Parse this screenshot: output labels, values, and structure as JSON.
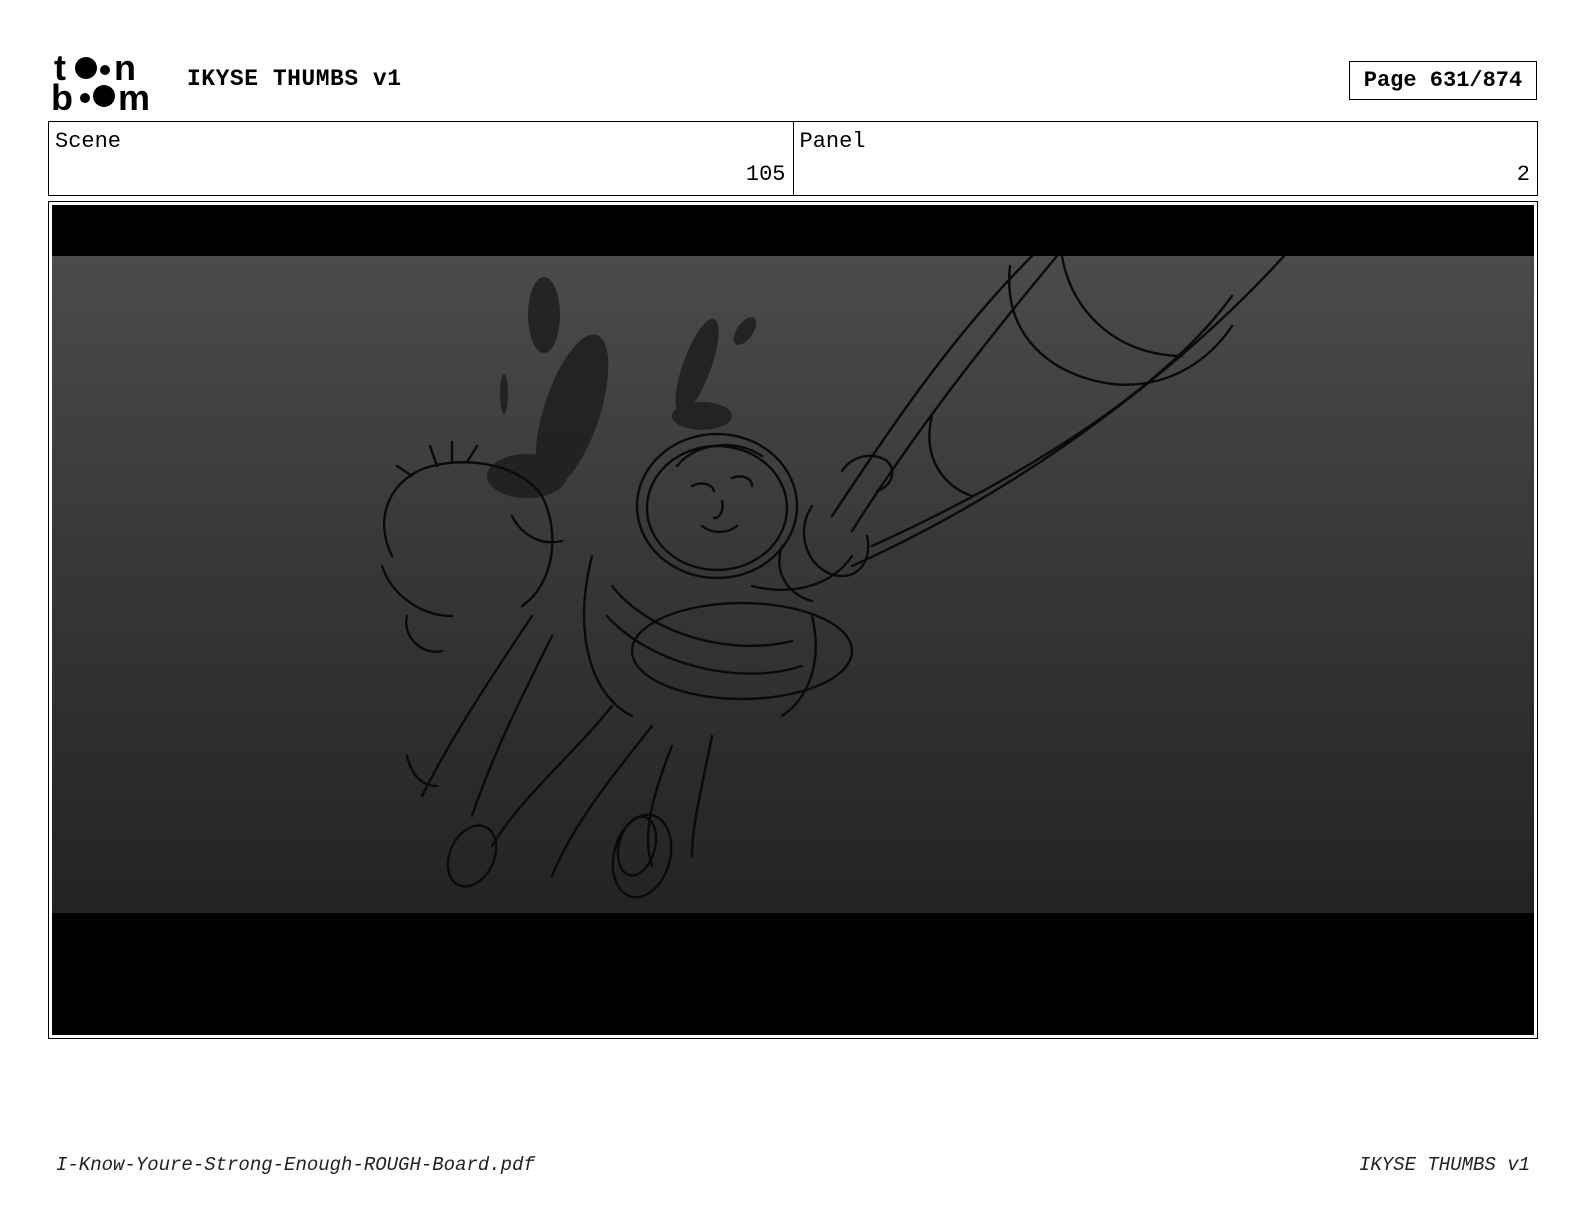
{
  "header": {
    "logo_text": "toon boom",
    "title": "IKYSE THUMBS v1",
    "page_indicator": "Page 631/874"
  },
  "info": {
    "scene_label": "Scene",
    "scene_value": "105",
    "panel_label": "Panel",
    "panel_value": "2"
  },
  "frame": {
    "letterbox_color": "#000000",
    "sketch_line_color": "#0a0a0a",
    "shadow_blob_color": "#1e1e1e"
  },
  "footer": {
    "filename": "I-Know-Youre-Strong-Enough-ROUGH-Board.pdf",
    "project": "IKYSE THUMBS v1"
  }
}
